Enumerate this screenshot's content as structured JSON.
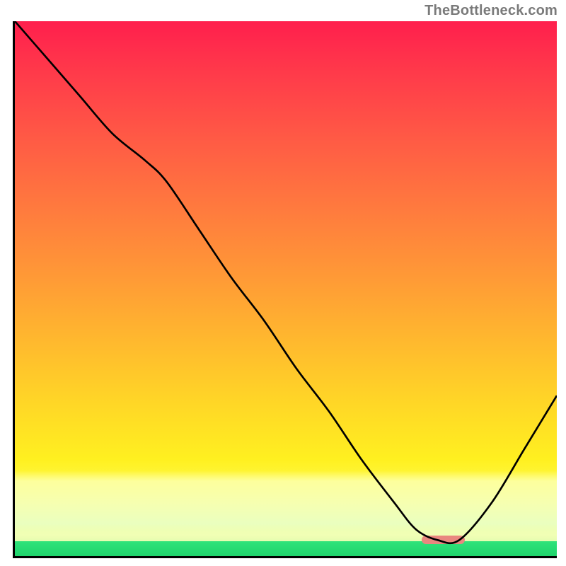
{
  "watermark": "TheBottleneck.com",
  "chart_data": {
    "type": "line",
    "title": "",
    "xlabel": "",
    "ylabel": "",
    "xlim": [
      0,
      100
    ],
    "ylim": [
      0,
      100
    ],
    "grid": false,
    "legend": false,
    "annotations": [],
    "background_gradient": {
      "stops": [
        {
          "pos": 0,
          "color": "#ff1f4d"
        },
        {
          "pos": 35,
          "color": "#ff7a3e"
        },
        {
          "pos": 72,
          "color": "#ffd826"
        },
        {
          "pos": 88,
          "color": "#fdff60"
        },
        {
          "pos": 97,
          "color": "#bff7b3"
        },
        {
          "pos": 100,
          "color": "#1fd36c"
        }
      ]
    },
    "series": [
      {
        "name": "bottleneck-curve",
        "x": [
          0,
          6,
          12,
          18,
          24,
          28,
          34,
          40,
          46,
          52,
          58,
          64,
          70,
          74,
          78,
          82,
          88,
          94,
          100
        ],
        "y": [
          100,
          93,
          86,
          79,
          74,
          70,
          61,
          52,
          44,
          35,
          27,
          18,
          10,
          5,
          3,
          3,
          10,
          20,
          30
        ]
      }
    ],
    "marker": {
      "name": "optimal-range",
      "x_start": 75,
      "x_end": 83,
      "y": 3,
      "color": "#e9877f"
    }
  }
}
